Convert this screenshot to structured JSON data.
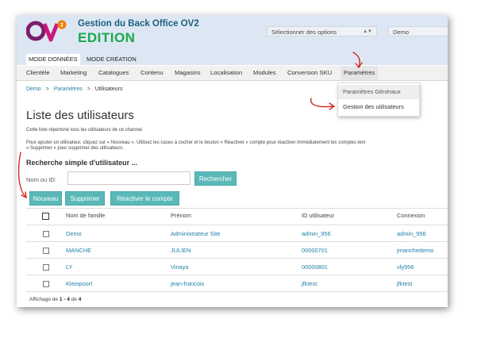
{
  "app": {
    "logo_text": "OV2",
    "title": "Gestion du Back Office OV2",
    "edition": "EDITION"
  },
  "header": {
    "options_select": "Sélectionner des options",
    "channel_select": "Demo"
  },
  "mode_tabs": [
    {
      "label": "MODE DONNÉES",
      "active": true
    },
    {
      "label": "MODE CRÉATION",
      "active": false
    }
  ],
  "nav": [
    {
      "label": "Clientèle"
    },
    {
      "label": "Marketing"
    },
    {
      "label": "Catalogues"
    },
    {
      "label": "Contenu"
    },
    {
      "label": "Magasins"
    },
    {
      "label": "Localisation"
    },
    {
      "label": "Modules"
    },
    {
      "label": "Conversion SKU"
    },
    {
      "label": "Paramètres",
      "active": true
    }
  ],
  "breadcrumb": [
    "Demo",
    "Paramètres",
    "Utilisateurs"
  ],
  "dropdown": [
    "Paramètres Généraux",
    "Gestion des utilisateurs"
  ],
  "page": {
    "title": "Liste des utilisateurs",
    "desc1": "Cette liste répertorie tous les utilisateurs de ce channel.",
    "desc2": "Pour ajouter un utilisateur, cliquez sur « Nouveau ». Utilisez les cases à cocher et le bouton « Réactiver » compte pour réactiver immédiatement les comptes tem",
    "desc3": "« Supprimer » pour supprimer des utilisateurs."
  },
  "search": {
    "title": "Recherche simple d'utilisateur ...",
    "label": "Nom ou ID:",
    "value": "",
    "button": "Rechercher"
  },
  "actions": {
    "new": "Nouveau",
    "delete": "Supprimer",
    "reactivate": "Réactiver le compte"
  },
  "table": {
    "headers": [
      "Nom de famille",
      "Prénom",
      "ID utilisateur",
      "Connexion"
    ],
    "rows": [
      [
        "Demo",
        "Administrateur Site",
        "admin_956",
        "admin_956"
      ],
      [
        "MANCHE",
        "JULIEN",
        "00000701",
        "jmanchedemo"
      ],
      [
        "LY",
        "Vinaya",
        "00000801",
        "vly956"
      ],
      [
        "Kleinpoort",
        "jean-francois",
        "jfktest",
        "jfktest"
      ]
    ]
  },
  "footer": {
    "prefix": "Affichage de",
    "range": "1 - 4",
    "of": "de",
    "total": "4"
  },
  "colors": {
    "accent": "#5ab8b8",
    "link": "#1f7fa6",
    "edition": "#1aa84a",
    "annotation": "#d22a1e",
    "header_bg": "#dde7f4"
  }
}
